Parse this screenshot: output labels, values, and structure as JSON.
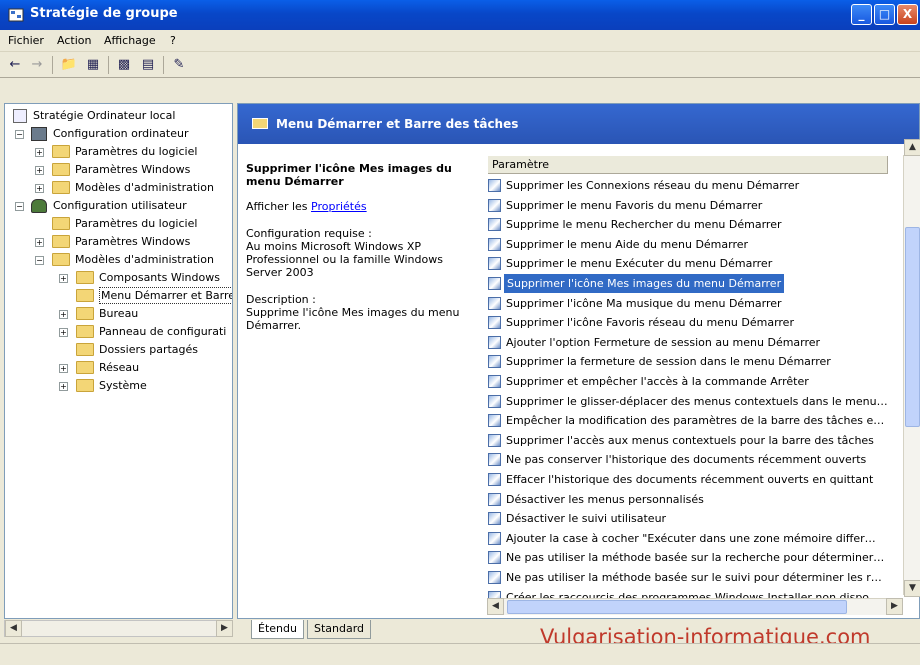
{
  "window": {
    "title": "Stratégie de groupe",
    "buttons": {
      "minimize": "_",
      "maximize": "□",
      "close": "X"
    }
  },
  "menu": [
    "Fichier",
    "Action",
    "Affichage",
    "?"
  ],
  "toolbar": {
    "back_icon": "arrow-left-icon",
    "forward_icon": "arrow-right-icon"
  },
  "tree": {
    "root": "Stratégie Ordinateur local",
    "computer_config": "Configuration ordinateur",
    "c_software": "Paramètres du logiciel",
    "c_windows": "Paramètres Windows",
    "c_admin": "Modèles d'administration",
    "user_config": "Configuration utilisateur",
    "u_software": "Paramètres du logiciel",
    "u_windows": "Paramètres Windows",
    "u_admin": "Modèles d'administration",
    "u_components": "Composants Windows",
    "u_startmenu": "Menu Démarrer et Barre",
    "u_desktop": "Bureau",
    "u_control": "Panneau de configurati",
    "u_shared": "Dossiers partagés",
    "u_network": "Réseau",
    "u_system": "Système"
  },
  "right_header": {
    "title": "Menu Démarrer et Barre des tâches"
  },
  "description": {
    "title": "Supprimer l'icône Mes images du menu Démarrer",
    "show_label": "Afficher les ",
    "properties_link": "Propriétés",
    "requirements_label": "Configuration requise :",
    "requirements_text": "Au moins Microsoft Windows XP Professionnel ou la famille Windows Server 2003",
    "description_label": "Description :",
    "description_text": "Supprime l'icône Mes images du menu Démarrer."
  },
  "list": {
    "column_header": "Paramètre",
    "selected_index": 5,
    "rows": [
      "Supprimer les Connexions réseau du menu Démarrer",
      "Supprimer le menu Favoris du menu Démarrer",
      "Supprime le menu Rechercher du menu Démarrer",
      "Supprimer le menu Aide du menu Démarrer",
      "Supprimer le menu Exécuter du menu Démarrer",
      "Supprimer l'icône Mes images du menu Démarrer",
      "Supprimer l'icône Ma musique du menu Démarrer",
      "Supprimer l'icône Favoris réseau du menu Démarrer",
      "Ajouter l'option Fermeture de session au menu Démarrer",
      "Supprimer la fermeture de session dans le menu Démarrer",
      "Supprimer et empêcher l'accès à la commande Arrêter",
      "Supprimer le glisser-déplacer des menus contextuels dans le menu…",
      "Empêcher la modification des paramètres de la barre des tâches e…",
      "Supprimer l'accès aux menus contextuels pour la barre des tâches",
      "Ne pas conserver l'historique des documents récemment ouverts",
      "Effacer l'historique des documents récemment ouverts en quittant",
      "Désactiver les menus personnalisés",
      "Désactiver le suivi utilisateur",
      "Ajouter la case à cocher \"Exécuter dans une zone mémoire differ…",
      "Ne pas utiliser la méthode basée sur la recherche pour déterminer…",
      "Ne pas utiliser la méthode basée sur le suivi pour déterminer les r…",
      "Créer les raccourcis des programmes Windows Installer non dispo…"
    ]
  },
  "tabs": [
    "Étendu",
    "Standard"
  ],
  "watermark": "Vulgarisation-informatique.com"
}
